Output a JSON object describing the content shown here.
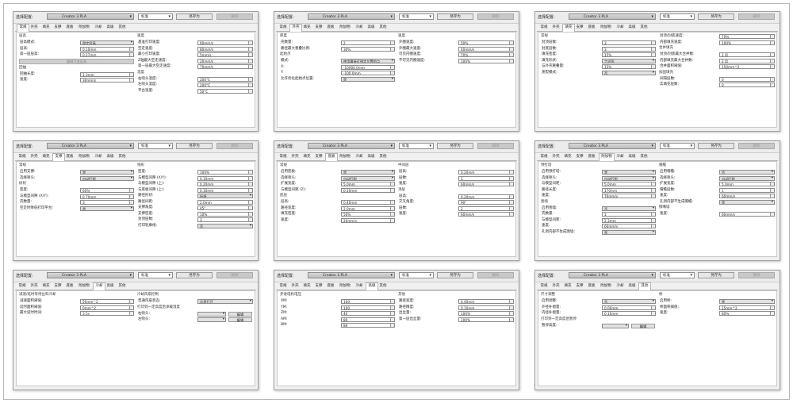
{
  "header": {
    "config_label": "选择配置:",
    "printer": "Creator 3 PLA",
    "quality": "标准",
    "save_as": "另存为",
    "delete": "删除"
  },
  "tabs": [
    "常规",
    "外壳",
    "填充",
    "支撑",
    "底板",
    "附加物",
    "冷却",
    "高级",
    "其他"
  ],
  "panels": [
    {
      "active_tab": 0,
      "left": [
        {
          "h": "层高"
        },
        {
          "l": "层高模式:",
          "v": "固定层高",
          "t": "sel"
        },
        {
          "l": "层高:",
          "v": "0.10mm",
          "t": "spin"
        },
        {
          "l": "第一层层高:",
          "v": "0.27mm",
          "t": "spin"
        },
        {
          "b": "编辑可变层高"
        },
        {
          "h": "回抽"
        },
        {
          "l": "回抽长度:",
          "v": "1.3mm",
          "t": "spin"
        },
        {
          "l": "速度:",
          "v": "30mm/s",
          "t": "spin"
        }
      ],
      "right": [
        {
          "h": "速度"
        },
        {
          "l": "基准打印速度:",
          "v": "60mm/s",
          "t": "spin"
        },
        {
          "l": "空走速度:",
          "v": "80mm/s",
          "t": "spin"
        },
        {
          "l": "最小打印速度:",
          "v": "5mm/s",
          "t": "spin"
        },
        {
          "l": "Z轴最大空走速度:",
          "v": "20mm/s",
          "t": "spin"
        },
        {
          "l": "第一层最大空走速度:",
          "v": "70mm/s",
          "t": "spin"
        },
        {
          "h": "温度"
        },
        {
          "l": "右喷头温度:",
          "v": "200°C",
          "t": "spin"
        },
        {
          "l": "左喷头温度:",
          "v": "200°C",
          "t": "spin"
        },
        {
          "l": "平台温度:",
          "v": "50°C",
          "t": "spin"
        }
      ]
    },
    {
      "active_tab": 1,
      "left": [
        {
          "h": "厚度"
        },
        {
          "l": "壳数量:",
          "v": "2",
          "t": "spin"
        },
        {
          "l": "路径最大重叠比例:",
          "v": "30%",
          "t": "spin"
        },
        {
          "h": "起始点"
        },
        {
          "l": "模式:",
          "v": "使用最接近指定位置的点",
          "t": "sel"
        },
        {
          "l": "X:",
          "v": "-10000.0mm",
          "t": "spin"
        },
        {
          "l": "Y:",
          "v": "-100.0mm",
          "t": "spin"
        },
        {
          "l": "允许优化起始点位置:",
          "v": "是",
          "t": "sel"
        }
      ],
      "right": [
        {
          "h": "速度"
        },
        {
          "l": "外圈速度:",
          "v": "50%",
          "t": "spin"
        },
        {
          "l": "外圈最大速度:",
          "v": "40mm/s",
          "t": "spin"
        },
        {
          "l": "可见内圈速度:",
          "v": "70%",
          "t": "spin"
        },
        {
          "l": "不可见内圈速度:",
          "v": "100%",
          "t": "spin"
        }
      ]
    },
    {
      "active_tab": 2,
      "left": [
        {
          "h": "常规"
        },
        {
          "l": "封顶层数:",
          "v": "3",
          "t": "spin"
        },
        {
          "l": "封底层数:",
          "v": "3",
          "t": "spin"
        },
        {
          "l": "填充密度:",
          "v": "15%",
          "t": "spin"
        },
        {
          "l": "填充形状:",
          "v": "六边形",
          "t": "sel"
        },
        {
          "l": "与外壳重叠量:",
          "v": "15%",
          "t": "spin"
        },
        {
          "l": "蒸熨模式:",
          "v": "否",
          "t": "sel"
        }
      ],
      "right": [
        {
          "l": "封顶/封底速度:",
          "v": "70%",
          "t": "spin"
        },
        {
          "l": "内部填充速度:",
          "v": "100%",
          "t": "spin"
        },
        {
          "h": "合并填充"
        },
        {
          "l": "封顶/封底最大合并数:",
          "v": "1 层",
          "t": "spin"
        },
        {
          "l": "内部填充最大合并数:",
          "v": "2 层",
          "t": "spin"
        },
        {
          "l": "合并面积阈值:",
          "v": "150mm^2",
          "t": "spin"
        },
        {
          "h": "加固填充"
        },
        {
          "l": "间隔层数:",
          "v": "0",
          "t": "spin"
        },
        {
          "l": "实填充层数:",
          "v": "0",
          "t": "spin"
        }
      ]
    },
    {
      "active_tab": 3,
      "left": [
        {
          "h": "常规"
        },
        {
          "l": "启用支撑:",
          "v": "是",
          "t": "sel"
        },
        {
          "l": "选择喷头:",
          "v": "自动匹配",
          "t": "sel"
        },
        {
          "h": "树状"
        },
        {
          "l": "密度:",
          "v": "60%",
          "t": "spin"
        },
        {
          "l": "与模型间隙 (X/Y):",
          "v": "0.70mm",
          "t": "spin"
        },
        {
          "l": "壳数量:",
          "v": "3",
          "t": "spin"
        },
        {
          "l": "空走时降低打印平台:",
          "v": "是",
          "t": "sel"
        }
      ],
      "right": [
        {
          "h": "线形"
        },
        {
          "l": "密度:",
          "v": "100%",
          "t": "spin"
        },
        {
          "l": "与模型间隙 (X/Y):",
          "v": "0.10mm",
          "t": "spin"
        },
        {
          "l": "与模型间隙 (上):",
          "v": "0.20mm",
          "t": "spin"
        },
        {
          "l": "与底板间隙 (上):",
          "v": "0.10mm",
          "t": "spin"
        },
        {
          "l": "路径形状:",
          "v": "折线",
          "t": "sel"
        },
        {
          "l": "路径间距:",
          "v": "2.0mm",
          "t": "spin"
        },
        {
          "l": "支撑角度:",
          "v": "45°",
          "t": "spin"
        },
        {
          "l": "支撑密度:",
          "v": "10%",
          "t": "spin"
        },
        {
          "l": "封顶层数:",
          "v": "3",
          "t": "spin"
        },
        {
          "l": "打印轮廓线:",
          "v": "否",
          "t": "sel"
        }
      ]
    },
    {
      "active_tab": 4,
      "left": [
        {
          "h": "常规"
        },
        {
          "l": "启用底板:",
          "v": "是",
          "t": "sel"
        },
        {
          "l": "选择喷头:",
          "v": "自动匹配",
          "t": "sel"
        },
        {
          "l": "扩展宽度:",
          "v": "5.0mm",
          "t": "spin"
        },
        {
          "l": "与模型间距 (Z):",
          "v": "0.10mm",
          "t": "spin"
        },
        {
          "h": "底层"
        },
        {
          "l": "层高:",
          "v": "0.40mm",
          "t": "spin"
        },
        {
          "l": "路径宽度:",
          "v": "2.0mm",
          "t": "spin"
        },
        {
          "l": "填充密度:",
          "v": "50%",
          "t": "spin"
        },
        {
          "l": "速度:",
          "v": "20mm/s",
          "t": "spin"
        }
      ],
      "right": [
        {
          "h": "中间层"
        },
        {
          "l": "层高:",
          "v": "0.20mm",
          "t": "spin"
        },
        {
          "l": "层数:",
          "v": "1",
          "t": "spin"
        },
        {
          "l": "速度:",
          "v": "60mm/s",
          "t": "spin"
        },
        {
          "h": "顶层"
        },
        {
          "l": "层高:",
          "v": "0.20mm",
          "t": "spin"
        },
        {
          "l": "交叉角度:",
          "v": "90°",
          "t": "spin"
        },
        {
          "l": "层数:",
          "v": "2",
          "t": "spin"
        },
        {
          "l": "速度:",
          "v": "60mm/s",
          "t": "spin"
        }
      ]
    },
    {
      "active_tab": 5,
      "left": [
        {
          "h": "预打塔"
        },
        {
          "l": "启用预打塔:",
          "v": "是",
          "t": "sel"
        },
        {
          "l": "选择喷头:",
          "v": "自动匹配",
          "t": "sel"
        },
        {
          "l": "与模型间距:",
          "v": "5.0mm",
          "t": "spin"
        },
        {
          "l": "路径长度:",
          "v": "170mm",
          "t": "spin"
        },
        {
          "l": "速度:",
          "v": "70mm/s",
          "t": "spin"
        },
        {
          "h": "围墙"
        },
        {
          "l": "启用围墙:",
          "v": "否",
          "t": "sel"
        },
        {
          "l": "壳数量:",
          "v": "1",
          "t": "spin"
        },
        {
          "l": "与模型间距:",
          "v": "2.3mm",
          "t": "spin"
        },
        {
          "l": "速度:",
          "v": "60mm/s",
          "t": "spin"
        },
        {
          "l": "孔洞内部不生成围墙:",
          "v": "是",
          "t": "sel"
        }
      ],
      "right": [
        {
          "h": "帽檐"
        },
        {
          "l": "启用帽檐:",
          "v": "否",
          "t": "sel"
        },
        {
          "l": "选择喷头:",
          "v": "自动匹配",
          "t": "sel"
        },
        {
          "l": "扩展宽度:",
          "v": "5.0mm",
          "t": "spin"
        },
        {
          "l": "帽檐层数:",
          "v": "1",
          "t": "spin"
        },
        {
          "l": "速度:",
          "v": "60mm/s",
          "t": "spin"
        },
        {
          "l": "孔洞内部不生成帽檐:",
          "v": "是",
          "t": "sel"
        },
        {
          "h": "擦嘴墙"
        },
        {
          "l": "速度:",
          "v": "60mm/s",
          "t": "spin"
        }
      ]
    },
    {
      "active_tab": 6,
      "left": [
        {
          "h": "减速/延时等待丝料冷却"
        },
        {
          "l": "减速面积阈值:",
          "v": "50mm^2",
          "t": "spin"
        },
        {
          "l": "延时面积阈值:",
          "v": "0mm^2",
          "t": "spin"
        },
        {
          "l": "最大延时时间:",
          "v": "3.5s",
          "t": "spin"
        }
      ],
      "right": [
        {
          "h": "冷却风扇控制"
        },
        {
          "l": "普通风扇状态:",
          "v": "总是打开",
          "t": "sel"
        },
        {
          "h": "打印到一定高度后承载温度"
        },
        {
          "l": "右喷头:",
          "v": "",
          "t": "sel",
          "btn": "编辑"
        },
        {
          "l": "左喷头:",
          "v": "",
          "t": "sel",
          "btn": "编辑"
        }
      ]
    },
    {
      "active_tab": 7,
      "left": [
        {
          "h": "步进电机电压"
        },
        {
          "l": "XM:",
          "v": "100",
          "t": "spin"
        },
        {
          "l": "YM:",
          "v": "100",
          "t": "spin"
        },
        {
          "l": "ZM:",
          "v": "40",
          "t": "spin"
        },
        {
          "l": "AM:",
          "v": "80",
          "t": "spin"
        },
        {
          "l": "BM:",
          "v": "80",
          "t": "spin"
        }
      ],
      "right": [
        {
          "h": "其他"
        },
        {
          "l": "路径宽度:",
          "v": "0.40mm",
          "t": "spin"
        },
        {
          "l": "路径精度:",
          "v": "0.10mm",
          "t": "spin"
        },
        {
          "l": "出丝量:",
          "v": "100%",
          "t": "spin"
        },
        {
          "l": "第一层出丝量:",
          "v": "100%",
          "t": "spin"
        }
      ]
    },
    {
      "active_tab": 8,
      "left": [
        {
          "h": "尺寸调整"
        },
        {
          "l": "启用调整:",
          "v": "否",
          "t": "sel"
        },
        {
          "l": "外径补偿量:",
          "v": "0.00mm",
          "t": "spin"
        },
        {
          "l": "内径补偿量:",
          "v": "0.10mm",
          "t": "spin"
        },
        {
          "h": "打印到一定高度后暂停"
        },
        {
          "l": "暂停高度:",
          "v": "",
          "t": "sel",
          "btn": "编辑"
        }
      ],
      "right": [
        {
          "h": "桥"
        },
        {
          "l": "启用桥:",
          "v": "是",
          "t": "sel"
        },
        {
          "l": "桥面积阈值:",
          "v": "15mm^2",
          "t": "spin"
        },
        {
          "l": "速度:",
          "v": "80%",
          "t": "spin"
        }
      ]
    }
  ]
}
